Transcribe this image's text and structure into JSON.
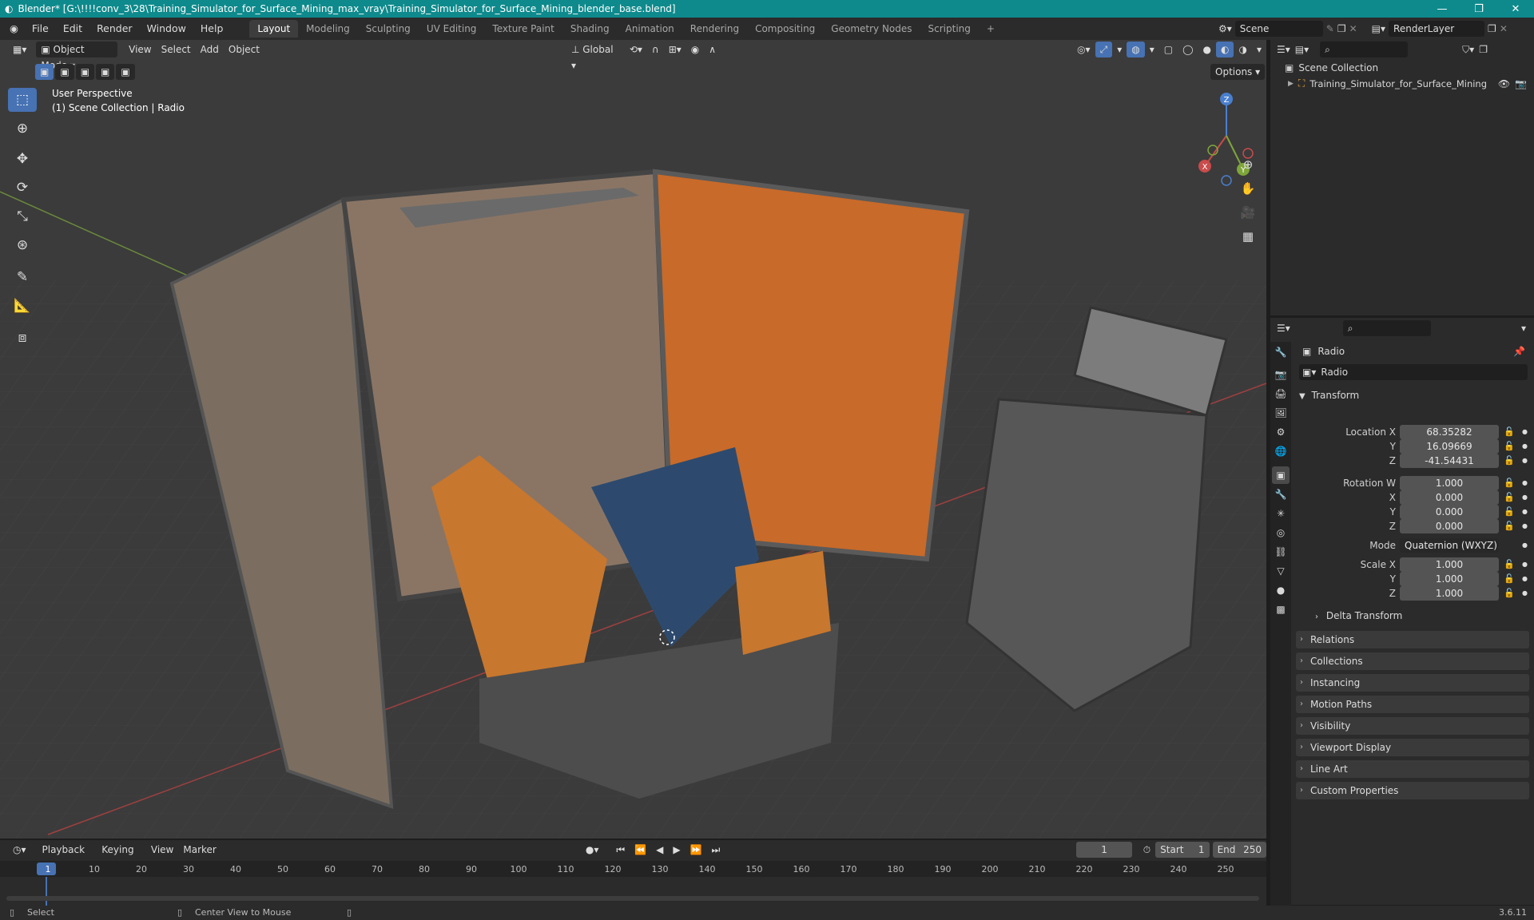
{
  "app": {
    "window_title": "Blender* [G:\\!!!!conv_3\\28\\Training_Simulator_for_Surface_Mining_max_vray\\Training_Simulator_for_Surface_Mining_blender_base.blend]",
    "window_buttons": [
      "—",
      "❐",
      "✕"
    ]
  },
  "menu": [
    "File",
    "Edit",
    "Render",
    "Window",
    "Help"
  ],
  "workspaces": [
    {
      "label": "Layout",
      "active": true
    },
    {
      "label": "Modeling"
    },
    {
      "label": "Sculpting"
    },
    {
      "label": "UV Editing"
    },
    {
      "label": "Texture Paint"
    },
    {
      "label": "Shading"
    },
    {
      "label": "Animation"
    },
    {
      "label": "Rendering"
    },
    {
      "label": "Compositing"
    },
    {
      "label": "Geometry Nodes"
    },
    {
      "label": "Scripting"
    }
  ],
  "add_workspace": "+",
  "scene_selector": {
    "label": "Scene"
  },
  "view_layer": {
    "label": "RenderLayer"
  },
  "viewport": {
    "mode": "Object Mode",
    "menus": [
      "View",
      "Select",
      "Add",
      "Object"
    ],
    "orientation": "Global",
    "options_label": "Options",
    "overlay_text_1": "User Perspective",
    "overlay_text_2": "(1) Scene Collection | Radio",
    "gizmo_axes": {
      "x": "X",
      "y": "Y",
      "z": "Z"
    },
    "accent": "#4772b3"
  },
  "outliner": {
    "root": "Scene Collection",
    "items": [
      {
        "label": "Training_Simulator_for_Surface_Mining"
      }
    ]
  },
  "properties": {
    "object_name": "Radio",
    "data_name": "Radio",
    "transform_title": "Transform",
    "rows": [
      {
        "label": "Location X",
        "value": "68.35282"
      },
      {
        "label": "Y",
        "value": "16.09669"
      },
      {
        "label": "Z",
        "value": "-41.54431"
      },
      {
        "label": "Rotation W",
        "value": "1.000"
      },
      {
        "label": "X",
        "value": "0.000"
      },
      {
        "label": "Y",
        "value": "0.000"
      },
      {
        "label": "Z",
        "value": "0.000"
      },
      {
        "label": "Mode",
        "value": "Quaternion (WXYZ)"
      },
      {
        "label": "Scale X",
        "value": "1.000"
      },
      {
        "label": "Y",
        "value": "1.000"
      },
      {
        "label": "Z",
        "value": "1.000"
      }
    ],
    "delta_transform": "Delta Transform",
    "panels": [
      "Relations",
      "Collections",
      "Instancing",
      "Motion Paths",
      "Visibility",
      "Viewport Display",
      "Line Art",
      "Custom Properties"
    ]
  },
  "timeline": {
    "menus": [
      "Playback",
      "Keying",
      "View",
      "Marker"
    ],
    "current_frame": "1",
    "start_label": "Start",
    "start": "1",
    "end_label": "End",
    "end": "250",
    "ruler": [
      "1",
      "10",
      "20",
      "30",
      "40",
      "50",
      "60",
      "70",
      "80",
      "90",
      "100",
      "110",
      "120",
      "130",
      "140",
      "150",
      "160",
      "170",
      "180",
      "190",
      "200",
      "210",
      "220",
      "230",
      "240",
      "250"
    ]
  },
  "status": {
    "select": "Select",
    "center_view": "Center View to Mouse",
    "version": "3.6.11"
  }
}
